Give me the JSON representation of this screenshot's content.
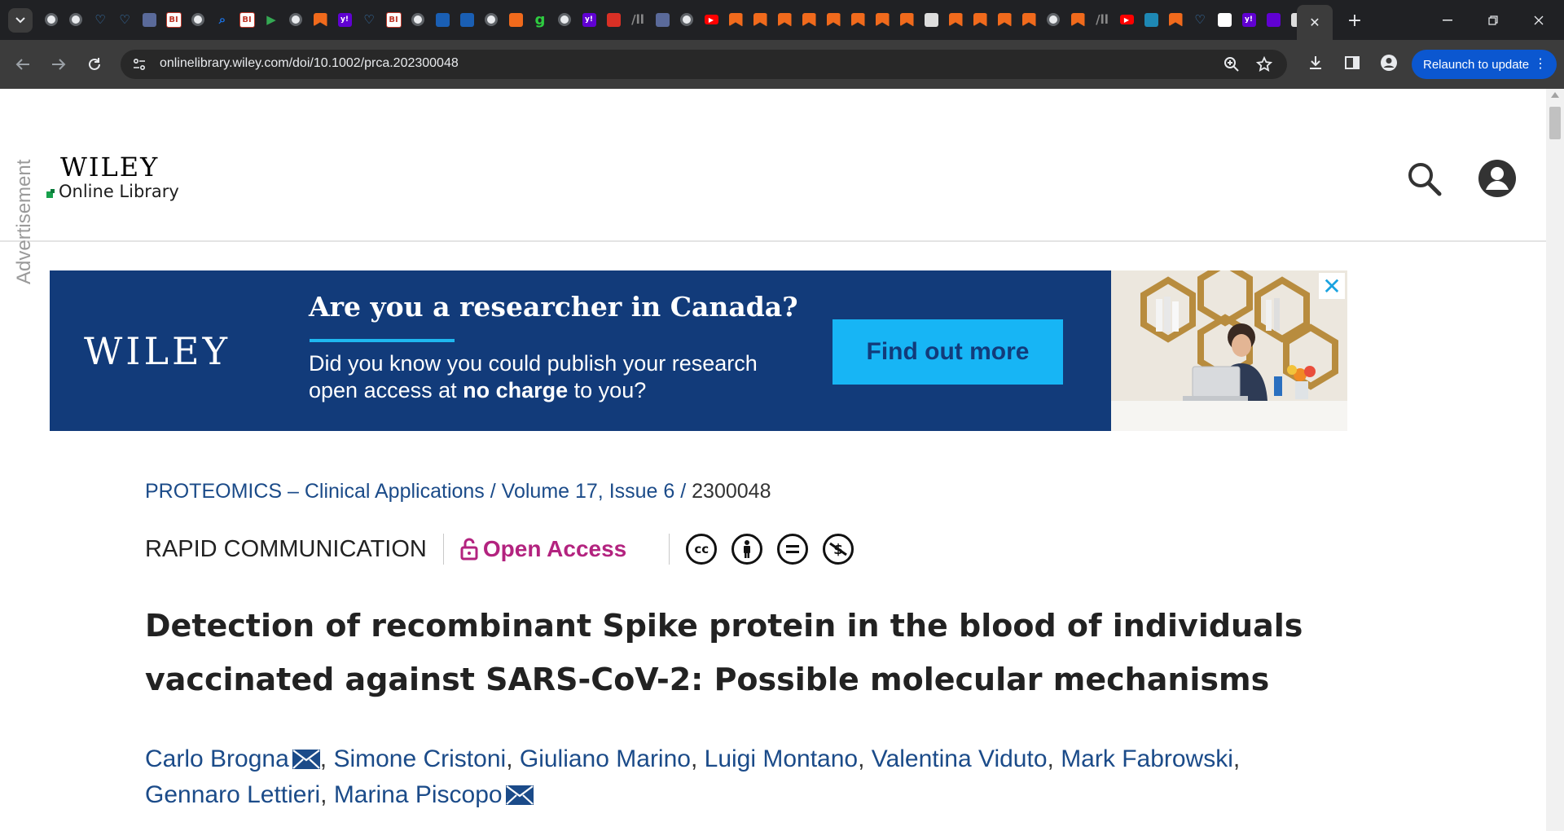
{
  "browser": {
    "url": "onlinelibrary.wiley.com/doi/10.1002/prca.202300048",
    "relaunch_label": "Relaunch to update",
    "new_tab": "+",
    "tab_favicons": [
      {
        "name": "chrome-globe-icon",
        "color": "#9aa0a6",
        "glyph": ""
      },
      {
        "name": "chrome-globe-icon",
        "color": "#9aa0a6",
        "glyph": ""
      },
      {
        "name": "heart-icon",
        "color": "#3b82c4",
        "glyph": "♡"
      },
      {
        "name": "heart-icon",
        "color": "#3b82c4",
        "glyph": "♡"
      },
      {
        "name": "arrow-icon",
        "color": "#5a6a9a",
        "glyph": ""
      },
      {
        "name": "bi-icon",
        "color": "#c0392b",
        "glyph": "BI"
      },
      {
        "name": "chrome-globe-icon",
        "color": "#9aa0a6",
        "glyph": ""
      },
      {
        "name": "search-icon",
        "color": "#1a73e8",
        "glyph": ""
      },
      {
        "name": "bi-icon",
        "color": "#c0392b",
        "glyph": "BI"
      },
      {
        "name": "play-icon",
        "color": "#34a853",
        "glyph": "▶"
      },
      {
        "name": "chrome-globe-icon",
        "color": "#9aa0a6",
        "glyph": ""
      },
      {
        "name": "bookmark-icon",
        "color": "#f06a1c",
        "glyph": ""
      },
      {
        "name": "yahoo-icon",
        "color": "#6001d2",
        "glyph": "y!"
      },
      {
        "name": "heart-icon",
        "color": "#3b82c4",
        "glyph": "♡"
      },
      {
        "name": "bi-icon",
        "color": "#c0392b",
        "glyph": "BI"
      },
      {
        "name": "chrome-globe-icon",
        "color": "#9aa0a6",
        "glyph": ""
      },
      {
        "name": "cube-icon",
        "color": "#1a5fb4",
        "glyph": ""
      },
      {
        "name": "cube-icon",
        "color": "#1a5fb4",
        "glyph": ""
      },
      {
        "name": "chrome-globe-icon",
        "color": "#9aa0a6",
        "glyph": ""
      },
      {
        "name": "shield-icon",
        "color": "#f06a1c",
        "glyph": ""
      },
      {
        "name": "g-icon",
        "color": "#2ecc40",
        "glyph": "g"
      },
      {
        "name": "chrome-globe-icon",
        "color": "#9aa0a6",
        "glyph": ""
      },
      {
        "name": "yahoo-icon",
        "color": "#6001d2",
        "glyph": "y!"
      },
      {
        "name": "download-icon",
        "color": "#d93025",
        "glyph": ""
      },
      {
        "name": "ll-icon",
        "color": "#888888",
        "glyph": "/ll"
      },
      {
        "name": "arrow-icon",
        "color": "#5a6a9a",
        "glyph": ""
      },
      {
        "name": "chrome-globe-icon",
        "color": "#9aa0a6",
        "glyph": ""
      },
      {
        "name": "youtube-icon",
        "color": "#ff0000",
        "glyph": "▶"
      },
      {
        "name": "bookmark-icon",
        "color": "#f06a1c",
        "glyph": ""
      },
      {
        "name": "bookmark-icon",
        "color": "#f06a1c",
        "glyph": ""
      },
      {
        "name": "bookmark-icon",
        "color": "#f06a1c",
        "glyph": ""
      },
      {
        "name": "bookmark-icon",
        "color": "#f06a1c",
        "glyph": ""
      },
      {
        "name": "bookmark-icon",
        "color": "#f06a1c",
        "glyph": ""
      },
      {
        "name": "bookmark-icon",
        "color": "#f06a1c",
        "glyph": ""
      },
      {
        "name": "bookmark-icon",
        "color": "#f06a1c",
        "glyph": ""
      },
      {
        "name": "bookmark-icon",
        "color": "#f06a1c",
        "glyph": ""
      },
      {
        "name": "newspaper-icon",
        "color": "#dddddd",
        "glyph": ""
      },
      {
        "name": "bookmark-icon",
        "color": "#f06a1c",
        "glyph": ""
      },
      {
        "name": "bookmark-icon",
        "color": "#f06a1c",
        "glyph": ""
      },
      {
        "name": "bookmark-icon",
        "color": "#f06a1c",
        "glyph": ""
      },
      {
        "name": "bookmark-icon",
        "color": "#f06a1c",
        "glyph": ""
      },
      {
        "name": "chrome-globe-icon",
        "color": "#9aa0a6",
        "glyph": ""
      },
      {
        "name": "bookmark-icon",
        "color": "#f06a1c",
        "glyph": ""
      },
      {
        "name": "ll-icon",
        "color": "#888888",
        "glyph": "/ll"
      },
      {
        "name": "youtube-icon",
        "color": "#ff0000",
        "glyph": "▶"
      },
      {
        "name": "eagle-icon",
        "color": "#1e88b4",
        "glyph": ""
      },
      {
        "name": "bookmark-icon",
        "color": "#f06a1c",
        "glyph": ""
      },
      {
        "name": "heart-icon",
        "color": "#3b82c4",
        "glyph": "♡"
      },
      {
        "name": "image-icon",
        "color": "#ffffff",
        "glyph": ""
      },
      {
        "name": "yahoo-icon",
        "color": "#6001d2",
        "glyph": "y!"
      },
      {
        "name": "mail-icon",
        "color": "#6001d2",
        "glyph": ""
      },
      {
        "name": "rss-icon",
        "color": "#dddddd",
        "glyph": ""
      }
    ]
  },
  "site": {
    "logo_wiley": "WILEY",
    "logo_ol": "Online Library"
  },
  "ad": {
    "label": "Advertisement",
    "brand": "WILEY",
    "headline": "Are you a researcher in Canada?",
    "body_line1": "Did you know you could publish your research",
    "body_line2_pre": "open access at ",
    "body_line2_bold": "no charge",
    "body_line2_post": " to you?",
    "cta": "Find out more",
    "close": "✕"
  },
  "article": {
    "breadcrumb": {
      "journal": "PROTEOMICS – Clinical Applications",
      "sep1": " / ",
      "volume": "Volume 17, Issue 6",
      "sep2": " / ",
      "article_number": " 2300048"
    },
    "type": "RAPID COMMUNICATION",
    "open_access": "Open Access",
    "license_icons": [
      "cc",
      "by",
      "nd",
      "nc"
    ],
    "title": "Detection of recombinant Spike protein in the blood of individuals vaccinated against SARS-CoV-2: Possible molecular mechanisms",
    "authors": [
      {
        "name": "Carlo Brogna",
        "corresponding": true
      },
      {
        "name": "Simone Cristoni",
        "corresponding": false
      },
      {
        "name": "Giuliano Marino",
        "corresponding": false
      },
      {
        "name": "Luigi Montano",
        "corresponding": false
      },
      {
        "name": "Valentina Viduto",
        "corresponding": false
      },
      {
        "name": "Mark Fabrowski",
        "corresponding": false
      },
      {
        "name": "Gennaro Lettieri",
        "corresponding": false
      },
      {
        "name": "Marina Piscopo",
        "corresponding": true
      }
    ]
  }
}
